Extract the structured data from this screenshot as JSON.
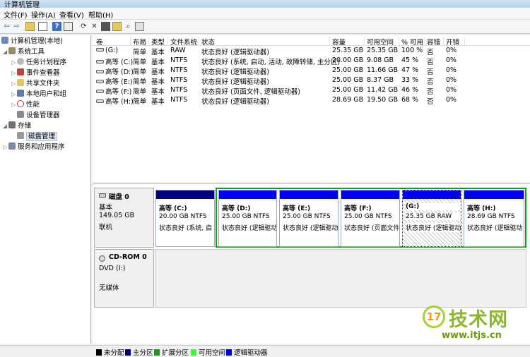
{
  "window": {
    "title": "计算机管理"
  },
  "menu": [
    "文件(F)",
    "操作(A)",
    "查看(V)",
    "帮助(H)"
  ],
  "toolbar": [
    "back-icon",
    "forward-icon",
    "up-icon",
    "show-tree-icon",
    "help-icon",
    "properties-icon",
    "refresh-icon",
    "delete-icon",
    "export-icon",
    "open-icon",
    "search-icon",
    "settings-icon"
  ],
  "tree": {
    "root": "计算机管理(本地)",
    "system_tools": "系统工具",
    "task_scheduler": "任务计划程序",
    "event_viewer": "事件查看器",
    "shared_folders": "共享文件夹",
    "local_users": "本地用户和组",
    "performance": "性能",
    "device_manager": "设备管理器",
    "storage": "存储",
    "disk_management": "磁盘管理",
    "services": "服务和应用程序"
  },
  "list": {
    "headers": [
      "卷",
      "布局",
      "类型",
      "文件系统",
      "状态",
      "容量",
      "可用空间",
      "% 可用",
      "容错",
      "开销"
    ],
    "rows": [
      [
        "(G:)",
        "简单",
        "基本",
        "RAW",
        "状态良好 (逻辑驱动器)",
        "25.35 GB",
        "25.35 GB",
        "100 %",
        "否",
        "0%"
      ],
      [
        "高等 (C:)",
        "简单",
        "基本",
        "NTFS",
        "状态良好 (系统, 启动, 活动, 故障转储, 主分区)",
        "20.00 GB",
        "9.08 GB",
        "45 %",
        "否",
        "0%"
      ],
      [
        "高等 (D:)",
        "简单",
        "基本",
        "NTFS",
        "状态良好 (逻辑驱动器)",
        "25.00 GB",
        "11.66 GB",
        "47 %",
        "否",
        "0%"
      ],
      [
        "高等 (E:)",
        "简单",
        "基本",
        "NTFS",
        "状态良好 (逻辑驱动器)",
        "25.00 GB",
        "8.37 GB",
        "33 %",
        "否",
        "0%"
      ],
      [
        "高等 (F:)",
        "简单",
        "基本",
        "NTFS",
        "状态良好 (页面文件, 逻辑驱动器)",
        "25.00 GB",
        "11.42 GB",
        "46 %",
        "否",
        "0%"
      ],
      [
        "高等 (H:)",
        "简单",
        "基本",
        "NTFS",
        "状态良好 (逻辑驱动器)",
        "28.69 GB",
        "19.50 GB",
        "68 %",
        "否",
        "0%"
      ]
    ]
  },
  "disk0": {
    "name": "磁盘 0",
    "type": "基本",
    "size": "149.05 GB",
    "status": "联机",
    "partitions": [
      {
        "name": "高等  (C:)",
        "size": "20.00 GB NTFS",
        "status": "状态良好 (系统, 启",
        "color": "#00007f"
      },
      {
        "name": "高等  (D:)",
        "size": "25.00 GB NTFS",
        "status": "状态良好 (逻辑驱动",
        "color": "#0000ff"
      },
      {
        "name": "高等  (E:)",
        "size": "25.00 GB NTFS",
        "status": "状态良好 (逻辑驱动",
        "color": "#0000ff"
      },
      {
        "name": "高等  (F:)",
        "size": "25.00 GB NTFS",
        "status": "状态良好 (页面文件",
        "color": "#0000ff"
      },
      {
        "name": "(G:)",
        "size": "25.35 GB RAW",
        "status": "状态良好 (逻辑驱动",
        "color": "#0000ff"
      },
      {
        "name": "高等  (H:)",
        "size": "28.69 GB NTFS",
        "status": "状态良好 (逻辑驱动",
        "color": "#0000ff"
      }
    ]
  },
  "cdrom": {
    "name": "CD-ROM 0",
    "type": "DVD (I:)",
    "media": "无媒体"
  },
  "legend": [
    {
      "label": "未分配",
      "color": "#000000"
    },
    {
      "label": "主分区",
      "color": "#00007f"
    },
    {
      "label": "扩展分区",
      "color": "#1a9a1a"
    },
    {
      "label": "可用空间",
      "color": "#33ff33"
    },
    {
      "label": "逻辑驱动器",
      "color": "#0000ff"
    }
  ],
  "watermark": {
    "brand": "技术网",
    "url": "www.itjs.cn"
  }
}
